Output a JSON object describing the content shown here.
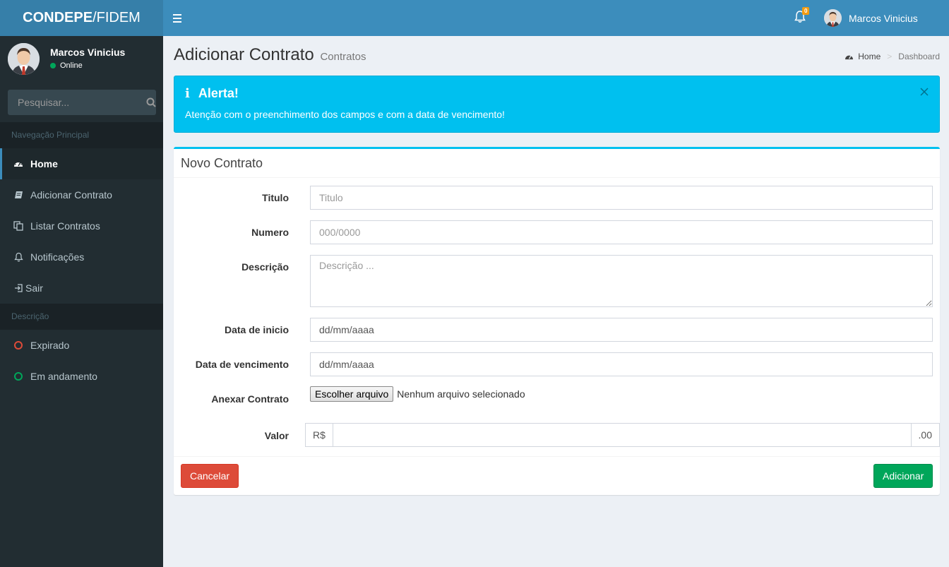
{
  "header": {
    "logo_bold": "CONDEPE",
    "logo_rest": "/FIDEM",
    "notification_count": "0",
    "user_name": "Marcos Vinicius"
  },
  "sidebar": {
    "user_name": "Marcos Vinicius",
    "user_status": "Online",
    "search_placeholder": "Pesquisar...",
    "nav_header": "Navegação Principal",
    "items": [
      {
        "label": "Home",
        "icon": "dashboard-icon"
      },
      {
        "label": "Adicionar Contrato",
        "icon": "book-icon"
      },
      {
        "label": "Listar Contratos",
        "icon": "copy-icon"
      },
      {
        "label": "Notificações",
        "icon": "bell-icon"
      },
      {
        "label": "Sair",
        "icon": "sign-out-icon"
      }
    ],
    "desc_header": "Descrição",
    "legend": [
      {
        "label": "Expirado",
        "color": "#dd4b39"
      },
      {
        "label": "Em andamento",
        "color": "#00a65a"
      }
    ]
  },
  "content": {
    "title": "Adicionar Contrato",
    "subtitle": "Contratos",
    "breadcrumb": {
      "home": "Home",
      "current": "Dashboard"
    }
  },
  "alert": {
    "title": "Alerta!",
    "text": "Atenção com o preenchimento dos campos e com a data de vencimento!"
  },
  "form": {
    "box_title": "Novo Contrato",
    "titulo": {
      "label": "Titulo",
      "placeholder": "Titulo"
    },
    "numero": {
      "label": "Numero",
      "placeholder": "000/0000"
    },
    "descricao": {
      "label": "Descrição",
      "placeholder": "Descrição ..."
    },
    "data_inicio": {
      "label": "Data de inicio",
      "value": "dd/mm/aaaa"
    },
    "data_vencimento": {
      "label": "Data de vencimento",
      "value": "dd/mm/aaaa"
    },
    "anexar": {
      "label": "Anexar Contrato",
      "button": "Escolher arquivo",
      "status": "Nenhum arquivo selecionado"
    },
    "valor": {
      "label": "Valor",
      "prefix": "R$",
      "suffix": ".00"
    },
    "cancel_label": "Cancelar",
    "submit_label": "Adicionar"
  }
}
